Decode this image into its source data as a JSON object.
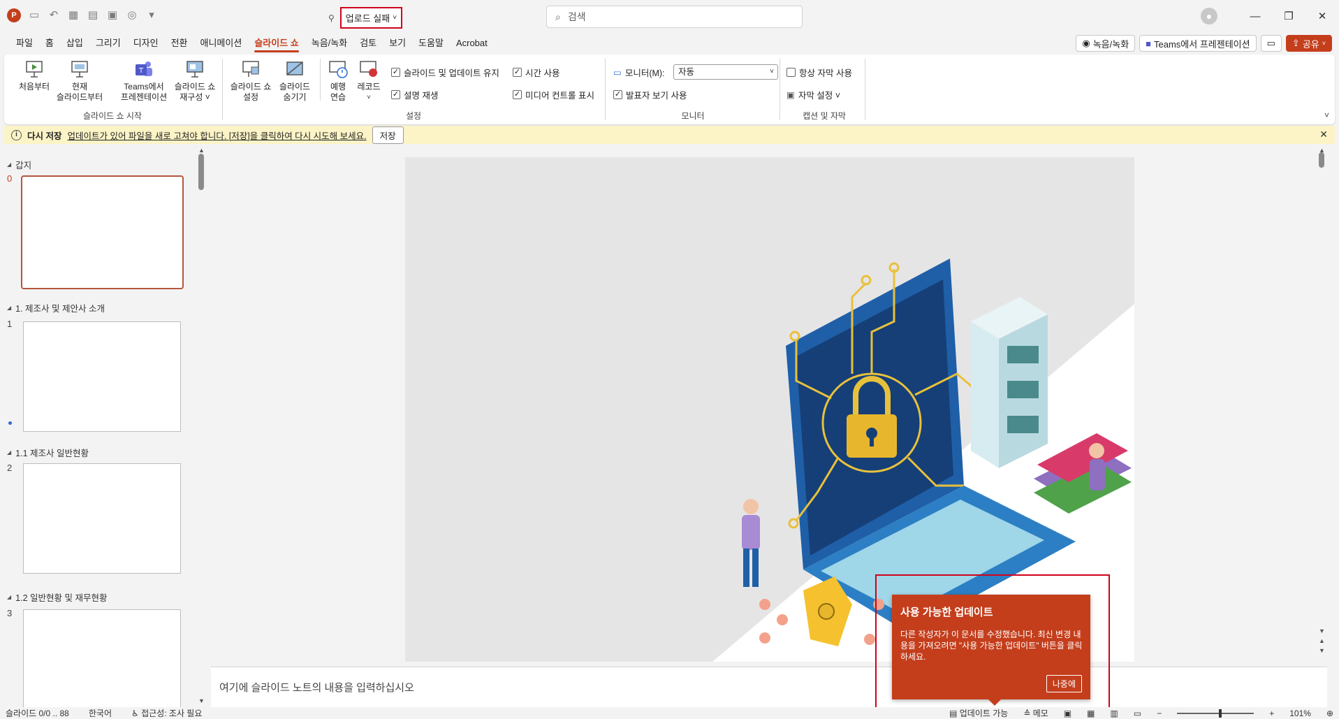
{
  "titlebar": {
    "app_logo": "P",
    "doc_status": "업로드 실패",
    "search_placeholder": "검색"
  },
  "menu": {
    "tabs": [
      "파일",
      "홈",
      "삽입",
      "그리기",
      "디자인",
      "전환",
      "애니메이션",
      "슬라이드 쇼",
      "녹음/녹화",
      "검토",
      "보기",
      "도움말",
      "Acrobat"
    ],
    "active_tab": "슬라이드 쇼",
    "record_btn": "녹음/녹화",
    "teams_btn": "Teams에서 프레젠테이션",
    "share_btn": "공유"
  },
  "ribbon": {
    "start_group": {
      "label": "슬라이드 쇼 시작",
      "from_beginning": "처음부터",
      "from_current_1": "현재",
      "from_current_2": "슬라이드부터",
      "teams_1": "Teams에서",
      "teams_2": "프레젠테이션",
      "custom_1": "슬라이드 쇼",
      "custom_2": "재구성 ˅"
    },
    "setup_group": {
      "label": "설정",
      "setup_1": "슬라이드 쇼",
      "setup_2": "설정",
      "hide_1": "슬라이드",
      "hide_2": "숨기기",
      "rehearse_1": "예행",
      "rehearse_2": "연습",
      "record": "레코드",
      "keep_updated": "슬라이드 및 업데이트 유지",
      "use_timings": "시간 사용",
      "play_narrations": "설명 재생",
      "show_media": "미디어 컨트롤 표시"
    },
    "monitor_group": {
      "label": "모니터",
      "monitor_label": "모니터(M):",
      "monitor_value": "자동",
      "presenter_view": "발표자 보기 사용"
    },
    "captions_group": {
      "label": "캡션 및 자막",
      "always_subtitles": "항상 자막 사용",
      "subtitle_settings": "자막 설정 ˅"
    }
  },
  "notice": {
    "title": "다시 저장",
    "message": "업데이트가 있어 파일을 새로 고쳐야 합니다. [저장]을 클릭하여 다시 시도해 보세요.",
    "button": "저장"
  },
  "thumbnails": {
    "sections": [
      "갑지",
      "1. 제조사 및 제안사 소개",
      "1.1 제조사 일반현황",
      "1.2 일반현황 및 재무현황"
    ],
    "slide_numbers": [
      "0",
      "1",
      "2",
      "3"
    ]
  },
  "notes_placeholder": "여기에 슬라이드 노트의 내용을 입력하십시오",
  "popup": {
    "title": "사용 가능한 업데이트",
    "body": "다른 작성자가 이 문서를 수정했습니다. 최신 변경 내용을 가져오려면 \"사용 가능한 업데이트\" 버튼을 클릭하세요.",
    "button": "나중에"
  },
  "status": {
    "slide_info": "슬라이드 0/0 .. 88",
    "language": "한국어",
    "accessibility": "접근성: 조사 필요",
    "update_available": "업데이트 가능",
    "notes": "메모",
    "zoom": "101%"
  },
  "colors": {
    "accent": "#c43e1c",
    "notice_bg": "#fcf4c6",
    "highlight_frame": "#d0021b"
  }
}
